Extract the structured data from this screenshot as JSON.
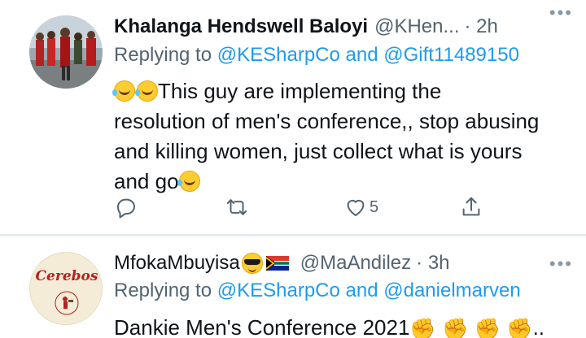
{
  "tweet1": {
    "author_name": "Khalanga Hendswell Baloyi",
    "handle": "@KHen...",
    "time": "· 2h",
    "more_label": "•••",
    "replying_prefix": "Replying to",
    "mention_1": "@KESharpCo",
    "and_word": "and",
    "mention_2": "@Gift11489150",
    "text_line_1": "This guy are implementing the",
    "text_line_2": "resolution of men's conference,, stop abusing",
    "text_line_3": "and killing women, just collect what is yours",
    "text_line_4": "and go",
    "like_count": "5"
  },
  "tweet2": {
    "author_name": "MfokaMbuyisa",
    "handle": "@MaAndilez",
    "time": "· 3h",
    "more_label": "•••",
    "replying_prefix": "Replying to",
    "mention_1": "@KESharpCo",
    "and_word": "and",
    "mention_2": "@danielmarven",
    "text": "Dankie Men's Conference 2021",
    "fists": "✊ ✊ ✊ ✊",
    "ellipsis": "..",
    "avatar_logo_text": "Cerebos"
  },
  "colors": {
    "link": "#1d9bf0",
    "secondary_text": "#536471",
    "divider": "#e7ecf0"
  }
}
